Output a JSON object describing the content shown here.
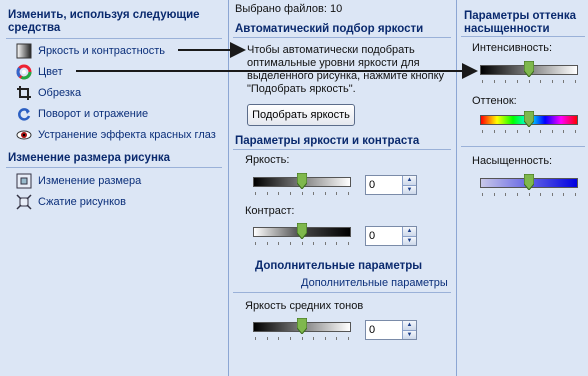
{
  "left": {
    "heading": "Изменить, используя следующие средства",
    "tasks": [
      {
        "label": "Яркость и контрастность",
        "icon": "brightness-contrast-icon"
      },
      {
        "label": "Цвет",
        "icon": "color-wheel-icon"
      },
      {
        "label": "Обрезка",
        "icon": "crop-icon"
      },
      {
        "label": "Поворот и отражение",
        "icon": "rotate-flip-icon"
      },
      {
        "label": "Устранение эффекта красных глаз",
        "icon": "red-eye-icon"
      }
    ],
    "resize_heading": "Изменение размера рисунка",
    "resize_tasks": [
      {
        "label": "Изменение размера",
        "icon": "resize-icon"
      },
      {
        "label": "Сжатие рисунков",
        "icon": "compress-icon"
      }
    ]
  },
  "middle": {
    "files_selected": "Выбрано файлов: 10",
    "auto_heading": "Автоматический подбор яркости",
    "auto_description": "Чтобы автоматически подобрать оптимальные уровни яркости для выделенного рисунка, нажмите кнопку \"Подобрать яркость\".",
    "auto_button": "Подобрать яркость",
    "params_heading": "Параметры яркости и контраста",
    "brightness_label": "Яркость:",
    "brightness_value": "0",
    "brightness_level": 0.5,
    "contrast_label": "Контраст:",
    "contrast_value": "0",
    "contrast_level": 0.5,
    "more_heading": "Дополнительные параметры",
    "more_link": "Дополнительные параметры",
    "midtones_label": "Яркость средних тонов",
    "midtones_value": "0",
    "midtones_level": 0.5
  },
  "right": {
    "heading": "Параметры оттенка насыщенности",
    "intensity_label": "Интенсивность:",
    "intensity_level": 0.5,
    "hue_label": "Оттенок:",
    "hue_level": 0.5,
    "saturation_label": "Насыщенность:",
    "saturation_level": 0.5
  },
  "colors": {
    "panel_bg": "#dce6f5",
    "heading": "#0a2a6e",
    "link": "#0b2f7a",
    "arrow": "#1a1a1a"
  }
}
